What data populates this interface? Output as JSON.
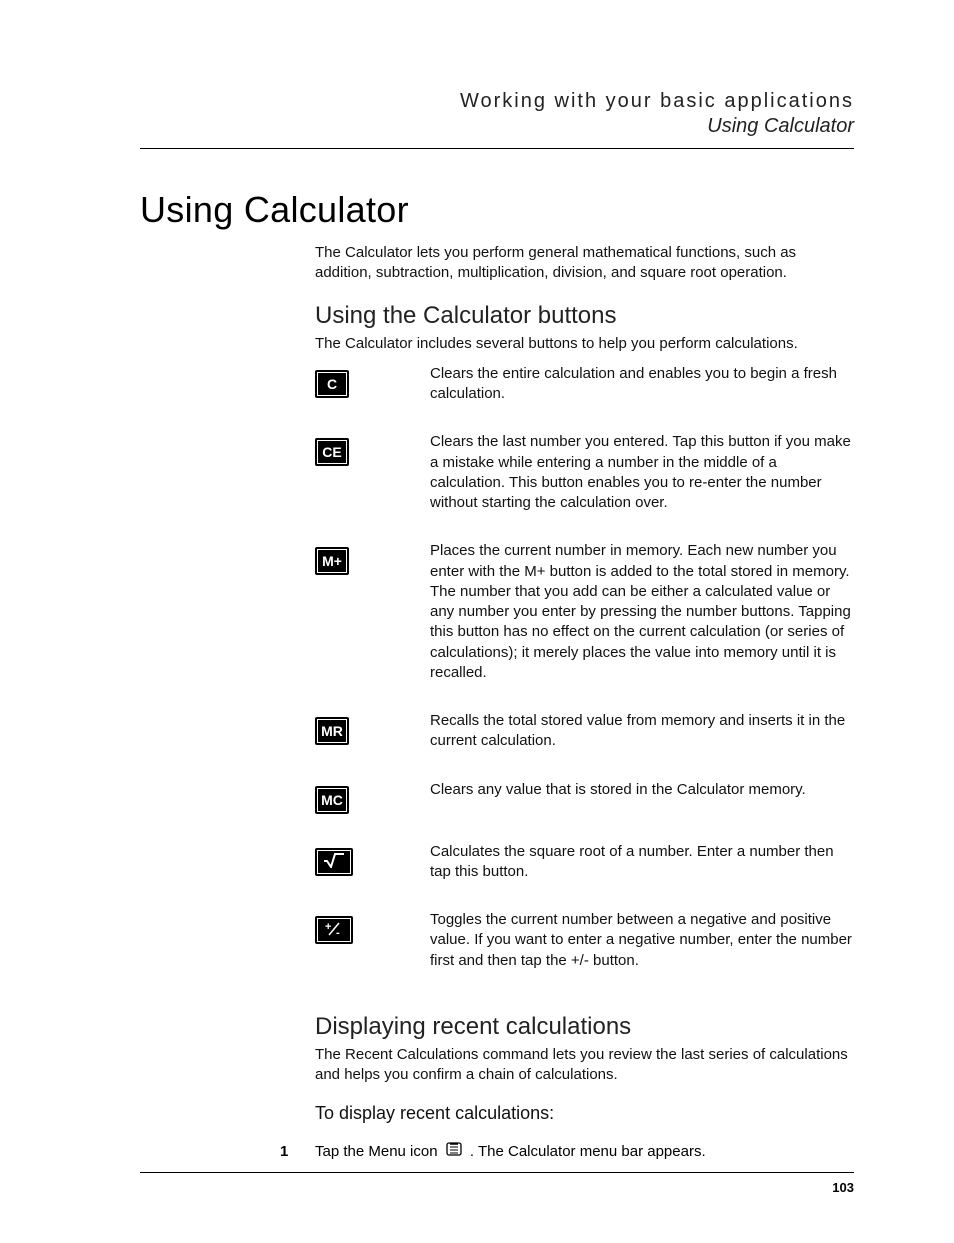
{
  "header": {
    "section": "Working with your basic applications",
    "subsection": "Using Calculator"
  },
  "title": "Using Calculator",
  "intro": "The Calculator lets you perform general mathematical functions, such as addition, subtraction, multiplication, division, and square root operation.",
  "buttons_heading": "Using the Calculator buttons",
  "buttons_intro": "The Calculator includes several buttons to help you perform calculations.",
  "buttons": [
    {
      "label": "C",
      "desc": "Clears the entire calculation and enables you to begin a fresh calculation."
    },
    {
      "label": "CE",
      "desc": "Clears the last number you entered. Tap this button if you make a mistake while entering a number in the middle of a calculation. This button enables you to re-enter the number without starting the calculation over."
    },
    {
      "label": "M+",
      "desc": "Places the current number in memory. Each new number you enter with the M+ button is added to the total stored in memory. The number that you add can be either a calculated value or any number you enter by pressing the number buttons. Tapping this button has no effect on the current calculation (or series of calculations); it merely places the value into memory until it is recalled."
    },
    {
      "label": "MR",
      "desc": "Recalls the total stored value from memory and inserts it in the current calculation."
    },
    {
      "label": "MC",
      "desc": "Clears any value that is stored in the Calculator memory."
    },
    {
      "label": "SQRT",
      "desc": "Calculates the square root of a number. Enter a number then tap this button."
    },
    {
      "label": "PM",
      "desc": "Toggles the current number between a negative and positive value. If you want to enter a negative number, enter the number first and then tap the +/- button."
    }
  ],
  "recent_heading": "Displaying recent calculations",
  "recent_intro": "The Recent Calculations command lets you review the last series of calculations and helps you confirm a chain of calculations.",
  "recent_sub": "To display recent calculations:",
  "step": {
    "num": "1",
    "before": "Tap the Menu icon",
    "after": ". The Calculator menu bar appears."
  },
  "page_number": "103"
}
